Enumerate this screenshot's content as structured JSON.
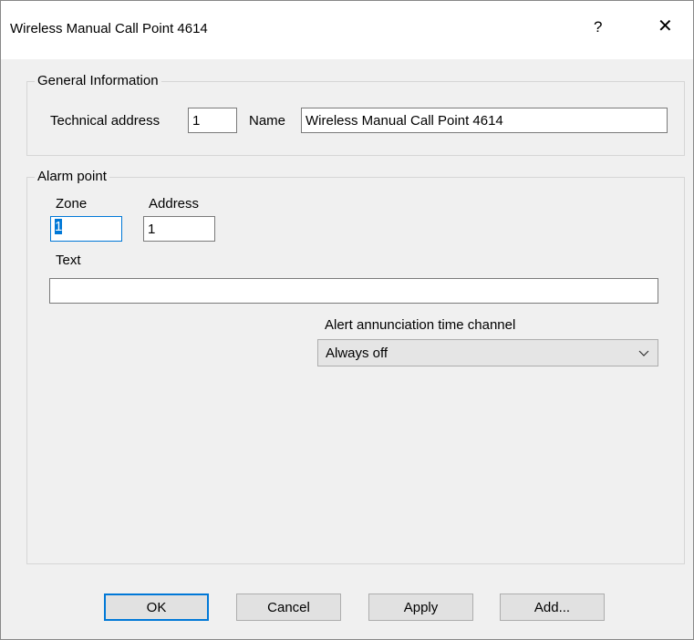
{
  "window": {
    "title": "Wireless Manual Call Point 4614",
    "help_label": "?",
    "close_label": "✕"
  },
  "general": {
    "legend": "General Information",
    "technical_address_label": "Technical address",
    "technical_address_value": "1",
    "name_label": "Name",
    "name_value": "Wireless Manual Call Point 4614"
  },
  "alarm": {
    "legend": "Alarm point",
    "zone_label": "Zone",
    "zone_value": "1",
    "address_label": "Address",
    "address_value": "1",
    "text_label": "Text",
    "text_value": "",
    "channel_label": "Alert annunciation time channel",
    "channel_value": "Always off",
    "icons": {
      "dropdown": "chevron-down-icon"
    }
  },
  "buttons": {
    "ok": "OK",
    "cancel": "Cancel",
    "apply": "Apply",
    "add": "Add..."
  },
  "colors": {
    "accent": "#0078d7",
    "titlebar": "#ffffff",
    "dialog_bg": "#f0f0f0"
  }
}
